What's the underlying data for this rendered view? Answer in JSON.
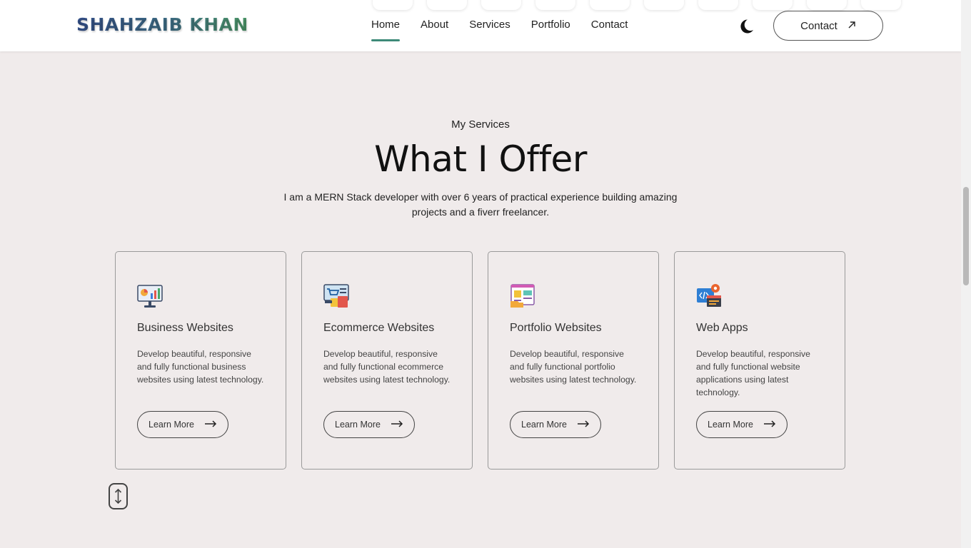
{
  "header": {
    "logo": "SHAHZAIB KHAN",
    "nav": [
      {
        "label": "Home",
        "active": true
      },
      {
        "label": "About",
        "active": false
      },
      {
        "label": "Services",
        "active": false
      },
      {
        "label": "Portfolio",
        "active": false
      },
      {
        "label": "Contact",
        "active": false
      }
    ],
    "theme_icon": "moon-icon",
    "contact_button": "Contact",
    "contact_icon": "arrow-up-right-icon"
  },
  "section": {
    "subtitle": "My Services",
    "title": "What I Offer",
    "description": "I am a MERN Stack developer with over 6 years of practical experience building amazing projects and a fiverr freelancer."
  },
  "cards": [
    {
      "title": "Business Websites",
      "text": "Develop beautiful, responsive and fully functional business websites using latest technology.",
      "button": "Learn More",
      "icon": "business-chart-icon"
    },
    {
      "title": "Ecommerce Websites",
      "text": "Develop beautiful, responsive and fully functional ecommerce websites using latest technology.",
      "button": "Learn More",
      "icon": "shopping-cart-icon"
    },
    {
      "title": "Portfolio Websites",
      "text": "Develop beautiful, responsive and fully functional portfolio websites using latest technology.",
      "button": "Learn More",
      "icon": "portfolio-icon"
    },
    {
      "title": "Web Apps",
      "text": "Develop beautiful, responsive and fully functional website applications using latest technology.",
      "button": "Learn More",
      "icon": "code-window-icon"
    }
  ],
  "colors": {
    "background": "#f0ebeb",
    "accent": "#3d8a78",
    "logo_gradient_start": "#35508a",
    "logo_gradient_end": "#4e9a6a"
  }
}
